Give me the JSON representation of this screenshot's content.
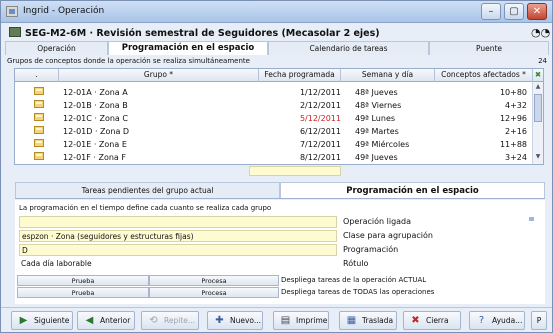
{
  "window": {
    "title": "Ingrid - Operación",
    "controls": [
      "–",
      "▢",
      "✕"
    ]
  },
  "header": {
    "title": "SEG-M2-6M · Revisión semestral de Seguidores (Mecasolar 2 ejes)"
  },
  "top_tabs": [
    {
      "label": "Operación"
    },
    {
      "label": "Programación en el espacio"
    },
    {
      "label": "Calendario de tareas"
    },
    {
      "label": "Puente"
    }
  ],
  "groups": {
    "caption": "Grupos de conceptos donde la operación se realiza simultáneamente",
    "count": "24",
    "columns": [
      ".",
      "Grupo *",
      "Fecha programada",
      "Semana y día",
      "Conceptos afectados *"
    ],
    "rows": [
      {
        "group": "12-01A · Zona A",
        "date": "1/12/2011",
        "week": "48ª Jueves",
        "concepts": "10+80",
        "red": false
      },
      {
        "group": "12-01B · Zona B",
        "date": "2/12/2011",
        "week": "48ª Viernes",
        "concepts": "4+32",
        "red": false
      },
      {
        "group": "12-01C · Zona C",
        "date": "5/12/2011",
        "week": "49ª Lunes",
        "concepts": "12+96",
        "red": true
      },
      {
        "group": "12-01D · Zona D",
        "date": "6/12/2011",
        "week": "49ª Martes",
        "concepts": "2+16",
        "red": false
      },
      {
        "group": "12-01E · Zona E",
        "date": "7/12/2011",
        "week": "49ª Miércoles",
        "concepts": "11+88",
        "red": false
      },
      {
        "group": "12-01F · Zona F",
        "date": "8/12/2011",
        "week": "49ª Jueves",
        "concepts": "3+24",
        "red": false
      }
    ]
  },
  "sub_tabs": [
    {
      "label": "Tareas pendientes del grupo actual"
    },
    {
      "label": "Programación en el espacio"
    }
  ],
  "panel": {
    "description": "La programación en el tiempo define cada cuanto se realiza cada grupo",
    "fields": [
      {
        "value": "",
        "label": "Operación ligada"
      },
      {
        "value": "espzon · Zona (seguidores y estructuras fijas)",
        "label": "Clase para agrupación"
      },
      {
        "value": "D",
        "label": "Programación"
      },
      {
        "value": "Cada día laborable",
        "label": "Rótulo"
      }
    ],
    "actions": [
      {
        "test": "Prueba",
        "process": "Procesa",
        "text": "Despliega tareas de la operación ACTUAL"
      },
      {
        "test": "Prueba",
        "process": "Procesa",
        "text": "Despliega tareas de TODAS las operaciones"
      }
    ]
  },
  "toolbar": [
    {
      "label": "Siguiente",
      "icon": "▶",
      "color": "#2b7a2b"
    },
    {
      "label": "Anterior",
      "icon": "◀",
      "color": "#2b7a2b"
    },
    {
      "label": "Repite...",
      "icon": "⟲",
      "color": "#9aa3b0"
    },
    {
      "label": "Nuevo...",
      "icon": "✚",
      "color": "#3a5fa0"
    },
    {
      "label": "Imprime",
      "icon": "▤",
      "color": "#445"
    },
    {
      "label": "Traslada",
      "icon": "▦",
      "color": "#3a5fa0"
    },
    {
      "label": "Cierra",
      "icon": "✖",
      "color": "#c62828"
    },
    {
      "label": "Ayuda...",
      "icon": "?",
      "color": "#3a5fa0"
    },
    {
      "label": "P",
      "icon": "",
      "color": "#111"
    }
  ]
}
